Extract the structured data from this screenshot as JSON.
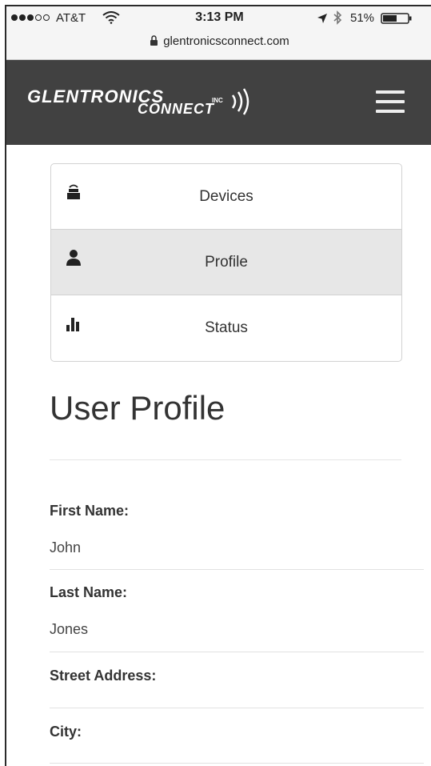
{
  "status_bar": {
    "carrier": "AT&T",
    "time": "3:13 PM",
    "battery": "51%",
    "url": "glentronicsconnect.com"
  },
  "header": {
    "logo_line1": "GLENTRONICS",
    "logo_inc": "INC",
    "logo_line2": "CONNECT"
  },
  "nav": {
    "items": [
      {
        "label": "Devices",
        "icon": "device-icon"
      },
      {
        "label": "Profile",
        "icon": "user-icon"
      },
      {
        "label": "Status",
        "icon": "bar-chart-icon"
      }
    ],
    "active": "Profile"
  },
  "profile": {
    "title": "User Profile",
    "fields": [
      {
        "label": "First Name:",
        "value": "John"
      },
      {
        "label": "Last Name:",
        "value": "Jones"
      },
      {
        "label": "Street Address:",
        "value": ""
      },
      {
        "label": "City:",
        "value": ""
      }
    ]
  },
  "colors": {
    "header_bg": "#414141",
    "active_nav_bg": "#e7e7e7",
    "text": "#333333"
  }
}
